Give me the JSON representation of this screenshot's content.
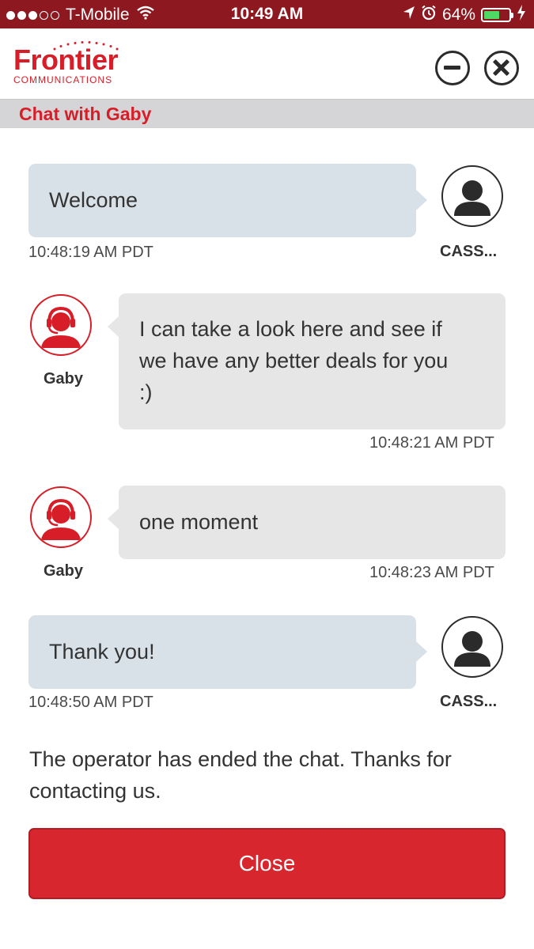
{
  "status_bar": {
    "carrier": "T-Mobile",
    "time": "10:49 AM",
    "battery_percent": "64%",
    "battery_level": 0.64,
    "icons": [
      "signal-dots-icon",
      "wifi-icon",
      "location-arrow-icon",
      "alarm-icon",
      "battery-icon",
      "charging-bolt-icon"
    ]
  },
  "header": {
    "logo_word": "Frontier",
    "logo_sub": "COMMUNICATIONS",
    "brand_color": "#d71e28",
    "minimize_icon": "minus-circle-icon",
    "close_icon": "x-circle-icon"
  },
  "chat": {
    "title": "Chat with Gaby",
    "messages": [
      {
        "from": "user",
        "name": "CASS...",
        "text": "Welcome",
        "time": "10:48:19 AM PDT"
      },
      {
        "from": "agent",
        "name": "Gaby",
        "lines": [
          "I can take a look here and see if",
          "we have any better deals for you",
          ":)"
        ],
        "time": "10:48:21 AM PDT"
      },
      {
        "from": "agent",
        "name": "Gaby",
        "text": "one moment",
        "time": "10:48:23 AM PDT"
      },
      {
        "from": "user",
        "name": "CASS...",
        "text": "Thank you!",
        "time": "10:48:50 AM PDT"
      }
    ],
    "ended_message": "The operator has ended the chat. Thanks for contacting us.",
    "close_button": "Close"
  }
}
